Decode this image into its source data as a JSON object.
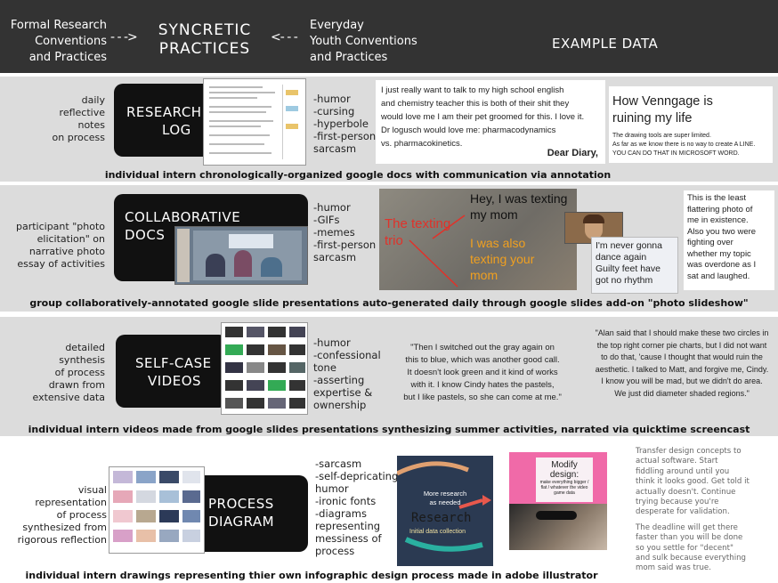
{
  "header": {
    "left_lines": [
      "Formal Research",
      "Conventions",
      "and Practices"
    ],
    "arrow_right": "- - ->",
    "center_lines": [
      "SYNCRETIC",
      "PRACTICES"
    ],
    "arrow_left": "<- - -",
    "right_lines": [
      "Everyday",
      "Youth Conventions",
      "and Practices"
    ],
    "example": "EXAMPLE DATA"
  },
  "rows": {
    "research_log": {
      "desc_lines": [
        "daily",
        "reflective",
        "notes",
        "on process"
      ],
      "label_lines": [
        "RESEARCH",
        "LOG"
      ],
      "traits": [
        "-humor",
        "-cursing",
        "-hyperbole",
        "-first-person",
        "sarcasm"
      ],
      "example1_lines": [
        "I just really want to talk to my high school english",
        "and chemistry teacher this is both of their shit they",
        "would love me I am their pet groomed for this. I love it.",
        "Dr logusch would love me: pharmacodynamics",
        "vs. pharmacokinetics."
      ],
      "diary": "Dear Diary,",
      "example2_title_lines": [
        "How Venngage is",
        "ruining my life"
      ],
      "example2_body_lines": [
        "The drawing tools are super limited.",
        "As far as we know there is no way to create A LINE.",
        "YOU CAN DO THAT IN MICROSOFT WORD."
      ],
      "caption": "individual intern chronologically-organized google docs with communication via annotation"
    },
    "collab_docs": {
      "desc_lines": [
        "participant \"photo",
        "elicitation\" on",
        "narrative photo",
        "essay of activities"
      ],
      "label_lines": [
        "COLLABORATIVE",
        "DOCS"
      ],
      "traits": [
        "-humor",
        "-GIFs",
        "-memes",
        "-first-person",
        "sarcasm"
      ],
      "slide_text1_lines": [
        "Hey, I was texting",
        "my mom"
      ],
      "slide_text2_lines": [
        "The texting",
        "trio"
      ],
      "slide_text3_lines": [
        "I was also",
        "texting your",
        "mom"
      ],
      "meme_lines": [
        "I'm never gonna",
        "dance again",
        "Guilty feet have",
        "got no rhythm"
      ],
      "side_note_lines": [
        "This is the least",
        "flattering photo of",
        "me in existence.",
        "Also you two were",
        "fighting over",
        "whether my topic",
        "was overdone as I",
        "sat and laughed."
      ],
      "caption": "group collaboratively-annotated google slide presentations auto-generated daily through google slides add-on \"photo slideshow\""
    },
    "self_case": {
      "desc_lines": [
        "detailed",
        "synthesis",
        "of process",
        "drawn from",
        "extensive data"
      ],
      "label_lines": [
        "SELF-CASE",
        "VIDEOS"
      ],
      "traits": [
        "-humor",
        "-confessional",
        "tone",
        "-asserting",
        "expertise &",
        "ownership"
      ],
      "quote1_lines": [
        "\"Then I switched out the gray again on",
        "this to blue, which was another good call.",
        "It doesn't look green and it kind of works",
        "with it. I know Cindy hates the pastels,",
        "but I like pastels, so she can come at me.\""
      ],
      "quote2_lines": [
        "\"Alan said that I should make these two circles in",
        "the top right corner pie charts, but I did not want",
        "to do that, 'cause I thought that would ruin the",
        "aesthetic. I talked to Matt, and forgive me, Cindy.",
        "I know you will be mad, but we didn't do area.",
        "We just did diameter shaded regions.\""
      ],
      "caption": "individual intern videos made from google slides presentations synthesizing summer activities, narrated via quicktime screencast"
    },
    "process": {
      "desc_lines": [
        "visual representation",
        "of process",
        "synthesized from",
        "rigorous reflection"
      ],
      "label_lines": [
        "PROCESS",
        "DIAGRAM"
      ],
      "traits": [
        "-sarcasm",
        "-self-depricating",
        "humor",
        "-ironic fonts",
        "-diagrams",
        "representing",
        "messiness of",
        "process"
      ],
      "diagram_lines": [
        "More research",
        "as needed"
      ],
      "diagram_big": "Research",
      "diagram_small": "Initial data collection",
      "modify_lines": [
        "Modify",
        "design:"
      ],
      "modify_small": "make everything bigger / flat / whatever the video game data",
      "advice_para1_lines": [
        "Transfer design concepts to",
        "actual software. Start",
        "fiddling around until you",
        "think it looks good. Get told it",
        "actually doesn't. Continue",
        "trying because you're",
        "desperate for validation."
      ],
      "advice_para2_lines": [
        "The deadline will get there",
        "faster than you will be done",
        "so you settle for \"decent\"",
        "and sulk because everything",
        "mom said was true."
      ],
      "caption": "individual intern drawings representing thier own infographic design process made in adobe illustrator"
    }
  }
}
